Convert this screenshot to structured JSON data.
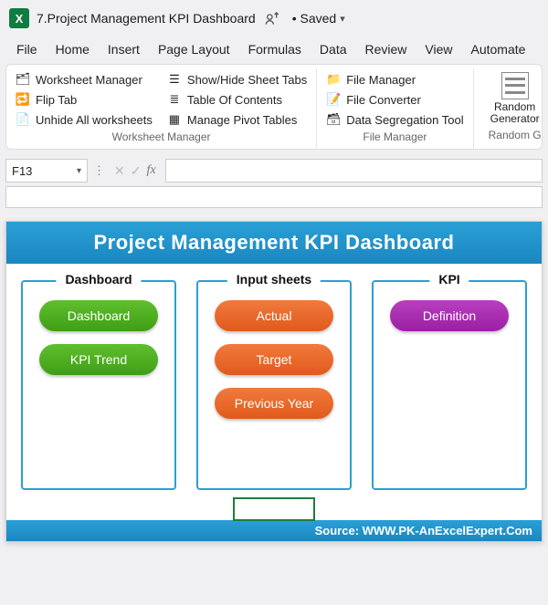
{
  "titlebar": {
    "filename": "7.Project Management KPI Dashboard",
    "saved_label": "• Saved"
  },
  "tabs": {
    "file": "File",
    "home": "Home",
    "insert": "Insert",
    "page_layout": "Page Layout",
    "formulas": "Formulas",
    "data": "Data",
    "review": "Review",
    "view": "View",
    "automate": "Automate"
  },
  "ribbon": {
    "group1": {
      "label": "Worksheet Manager",
      "cmds": {
        "worksheet_manager": "Worksheet Manager",
        "flip_tab": "Flip Tab",
        "unhide_all": "Unhide All worksheets",
        "show_hide_tabs": "Show/Hide Sheet Tabs",
        "toc": "Table Of Contents",
        "manage_pivot": "Manage Pivot Tables"
      }
    },
    "group2": {
      "label": "File Manager",
      "cmds": {
        "file_manager": "File Manager",
        "file_converter": "File Converter",
        "data_seg": "Data Segregation Tool"
      }
    },
    "group3": {
      "label": "Random G",
      "big_line1": "Random",
      "big_line2": "Generator"
    }
  },
  "namebox": {
    "value": "F13"
  },
  "fx": {
    "label": "fx"
  },
  "dashboard": {
    "title": "Project Management KPI Dashboard",
    "panel1": {
      "title": "Dashboard",
      "btn1": "Dashboard",
      "btn2": "KPI Trend"
    },
    "panel2": {
      "title": "Input sheets",
      "btn1": "Actual",
      "btn2": "Target",
      "btn3": "Previous Year"
    },
    "panel3": {
      "title": "KPI",
      "btn1": "Definition"
    },
    "source": "Source: WWW.PK-AnExcelExpert.Com"
  }
}
